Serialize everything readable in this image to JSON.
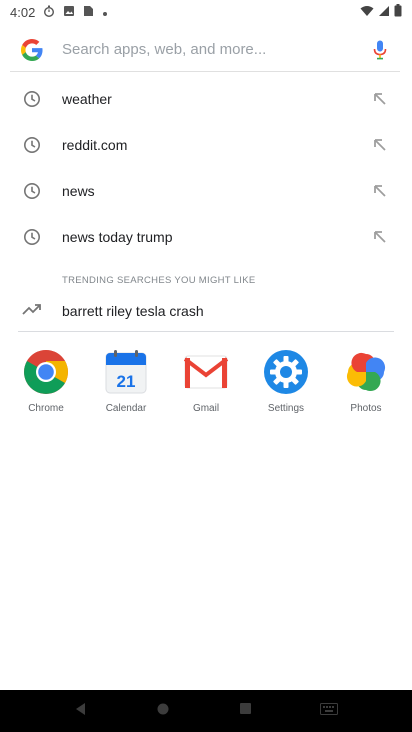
{
  "status_bar": {
    "time": "4:02",
    "left_icons": [
      "stopwatch-icon",
      "image-icon",
      "file-icon",
      "dot-icon"
    ],
    "right_icons": [
      "wifi-icon",
      "signal-icon",
      "battery-icon"
    ]
  },
  "search": {
    "placeholder": "Search apps, web, and more...",
    "value": ""
  },
  "suggestions": [
    {
      "label": "weather"
    },
    {
      "label": "reddit.com"
    },
    {
      "label": "news"
    },
    {
      "label": "news today trump"
    }
  ],
  "trending": {
    "header": "TRENDING SEARCHES YOU MIGHT LIKE",
    "items": [
      {
        "label": "barrett riley tesla crash"
      }
    ]
  },
  "apps": [
    {
      "label": "Chrome"
    },
    {
      "label": "Calendar",
      "day": "21"
    },
    {
      "label": "Gmail"
    },
    {
      "label": "Settings"
    },
    {
      "label": "Photos"
    }
  ],
  "colors": {
    "google_blue": "#4285f4",
    "google_red": "#ea4335",
    "google_yellow": "#fbbc05",
    "google_green": "#34a853"
  }
}
